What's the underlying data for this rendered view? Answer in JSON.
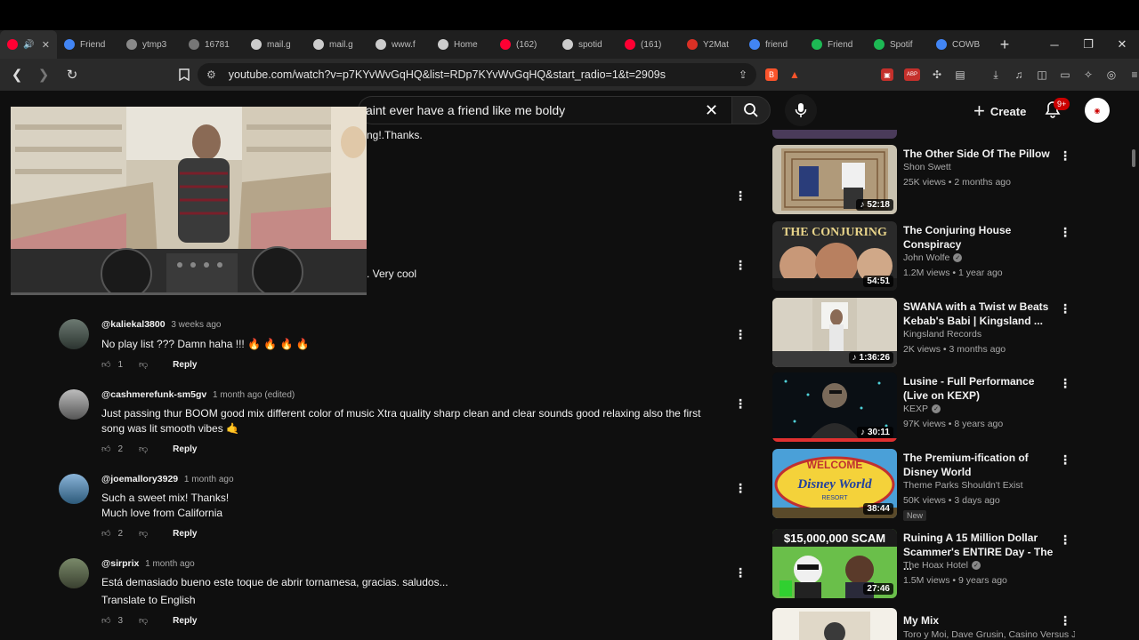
{
  "browser": {
    "tabs": [
      {
        "label": "",
        "color": "#ff0033",
        "active": true
      },
      {
        "label": "Friend",
        "color": "#4285f4"
      },
      {
        "label": "ytmp3",
        "color": "#888888"
      },
      {
        "label": "16781",
        "color": "#777777"
      },
      {
        "label": "mail.g",
        "color": "#cccccc"
      },
      {
        "label": "mail.g",
        "color": "#cccccc"
      },
      {
        "label": "www.f",
        "color": "#cccccc"
      },
      {
        "label": "Home",
        "color": "#cccccc"
      },
      {
        "label": "(162)",
        "color": "#ff0033"
      },
      {
        "label": "spotid",
        "color": "#cccccc"
      },
      {
        "label": "(161)",
        "color": "#ff0033"
      },
      {
        "label": "Y2Mat",
        "color": "#d93025"
      },
      {
        "label": "friend",
        "color": "#4285f4"
      },
      {
        "label": "Friend",
        "color": "#1db954"
      },
      {
        "label": "Spotif",
        "color": "#1db954"
      },
      {
        "label": "COWB",
        "color": "#4285f4"
      }
    ],
    "url": "youtube.com/watch?v=p7KYvWvGqHQ&list=RDp7KYvWvGqHQ&start_radio=1&t=2909s",
    "new_tab_glyph": "+"
  },
  "masthead": {
    "search_value": "aint ever have a friend like me boldy",
    "create_label": "Create",
    "notif_count": "9+"
  },
  "comments": {
    "snippet_1": "ng!.Thanks.",
    "snippet_2": ". Very cool",
    "items": [
      {
        "handle": "@kaliekal3800",
        "time": "3 weeks ago",
        "text": "No play list ??? Damn haha !!! 🔥 🔥 🔥 🔥",
        "likes": "1",
        "reply": "Reply"
      },
      {
        "handle": "@cashmerefunk-sm5gv",
        "time": "1 month ago (edited)",
        "text": "Just passing thur BOOM good mix different color of music Xtra quality sharp clean and clear sounds good relaxing also the first song was lit smooth vibes 🤙",
        "likes": "2",
        "reply": "Reply"
      },
      {
        "handle": "@joemallory3929",
        "time": "1 month ago",
        "text": "Such a sweet mix! Thanks!\nMuch love from California",
        "likes": "2",
        "reply": "Reply"
      },
      {
        "handle": "@sirprix",
        "time": "1 month ago",
        "text": "Está demasiado bueno este toque de abrir tornamesa, gracias. saludos...",
        "translate": "Translate to English",
        "likes": "3",
        "reply": "Reply"
      }
    ]
  },
  "sidebar": [
    {
      "title": "The Other Side Of The Pillow",
      "channel": "Shon Swett",
      "meta": "25K views • 2 months ago",
      "duration": "52:18",
      "verified": false
    },
    {
      "title": "The Conjuring House Conspiracy",
      "channel": "John Wolfe",
      "meta": "1.2M views • 1 year ago",
      "duration": "54:51",
      "verified": true
    },
    {
      "title": "SWANA with a Twist w Beats Kebab's Babi | Kingsland ...",
      "channel": "Kingsland Records",
      "meta": "2K views • 3 months ago",
      "duration": "1:36:26",
      "verified": false
    },
    {
      "title": "Lusine - Full Performance (Live on KEXP)",
      "channel": "KEXP",
      "meta": "97K views • 8 years ago",
      "duration": "30:11",
      "verified": true
    },
    {
      "title": "The Premium-ification of Disney World",
      "channel": "Theme Parks Shouldn't Exist",
      "meta": "50K views • 3 days ago",
      "duration": "38:44",
      "verified": false,
      "badge": "New"
    },
    {
      "title": "Ruining A 15 Million Dollar Scammer's ENTIRE Day - The ...",
      "channel": "The Hoax Hotel",
      "meta": "1.5M views • 9 years ago",
      "duration": "27:46",
      "verified": true,
      "thumb_text": "$15,000,000 SCAM"
    },
    {
      "title": "My Mix",
      "channel": "Toro y Moi, Dave Grusin, Casino Versus J..."
    }
  ],
  "thumb_texts": {
    "conjuring": "THE CONJURING",
    "welcome": "WELCOME",
    "disney": "Disney World",
    "resort": "RESORT"
  }
}
